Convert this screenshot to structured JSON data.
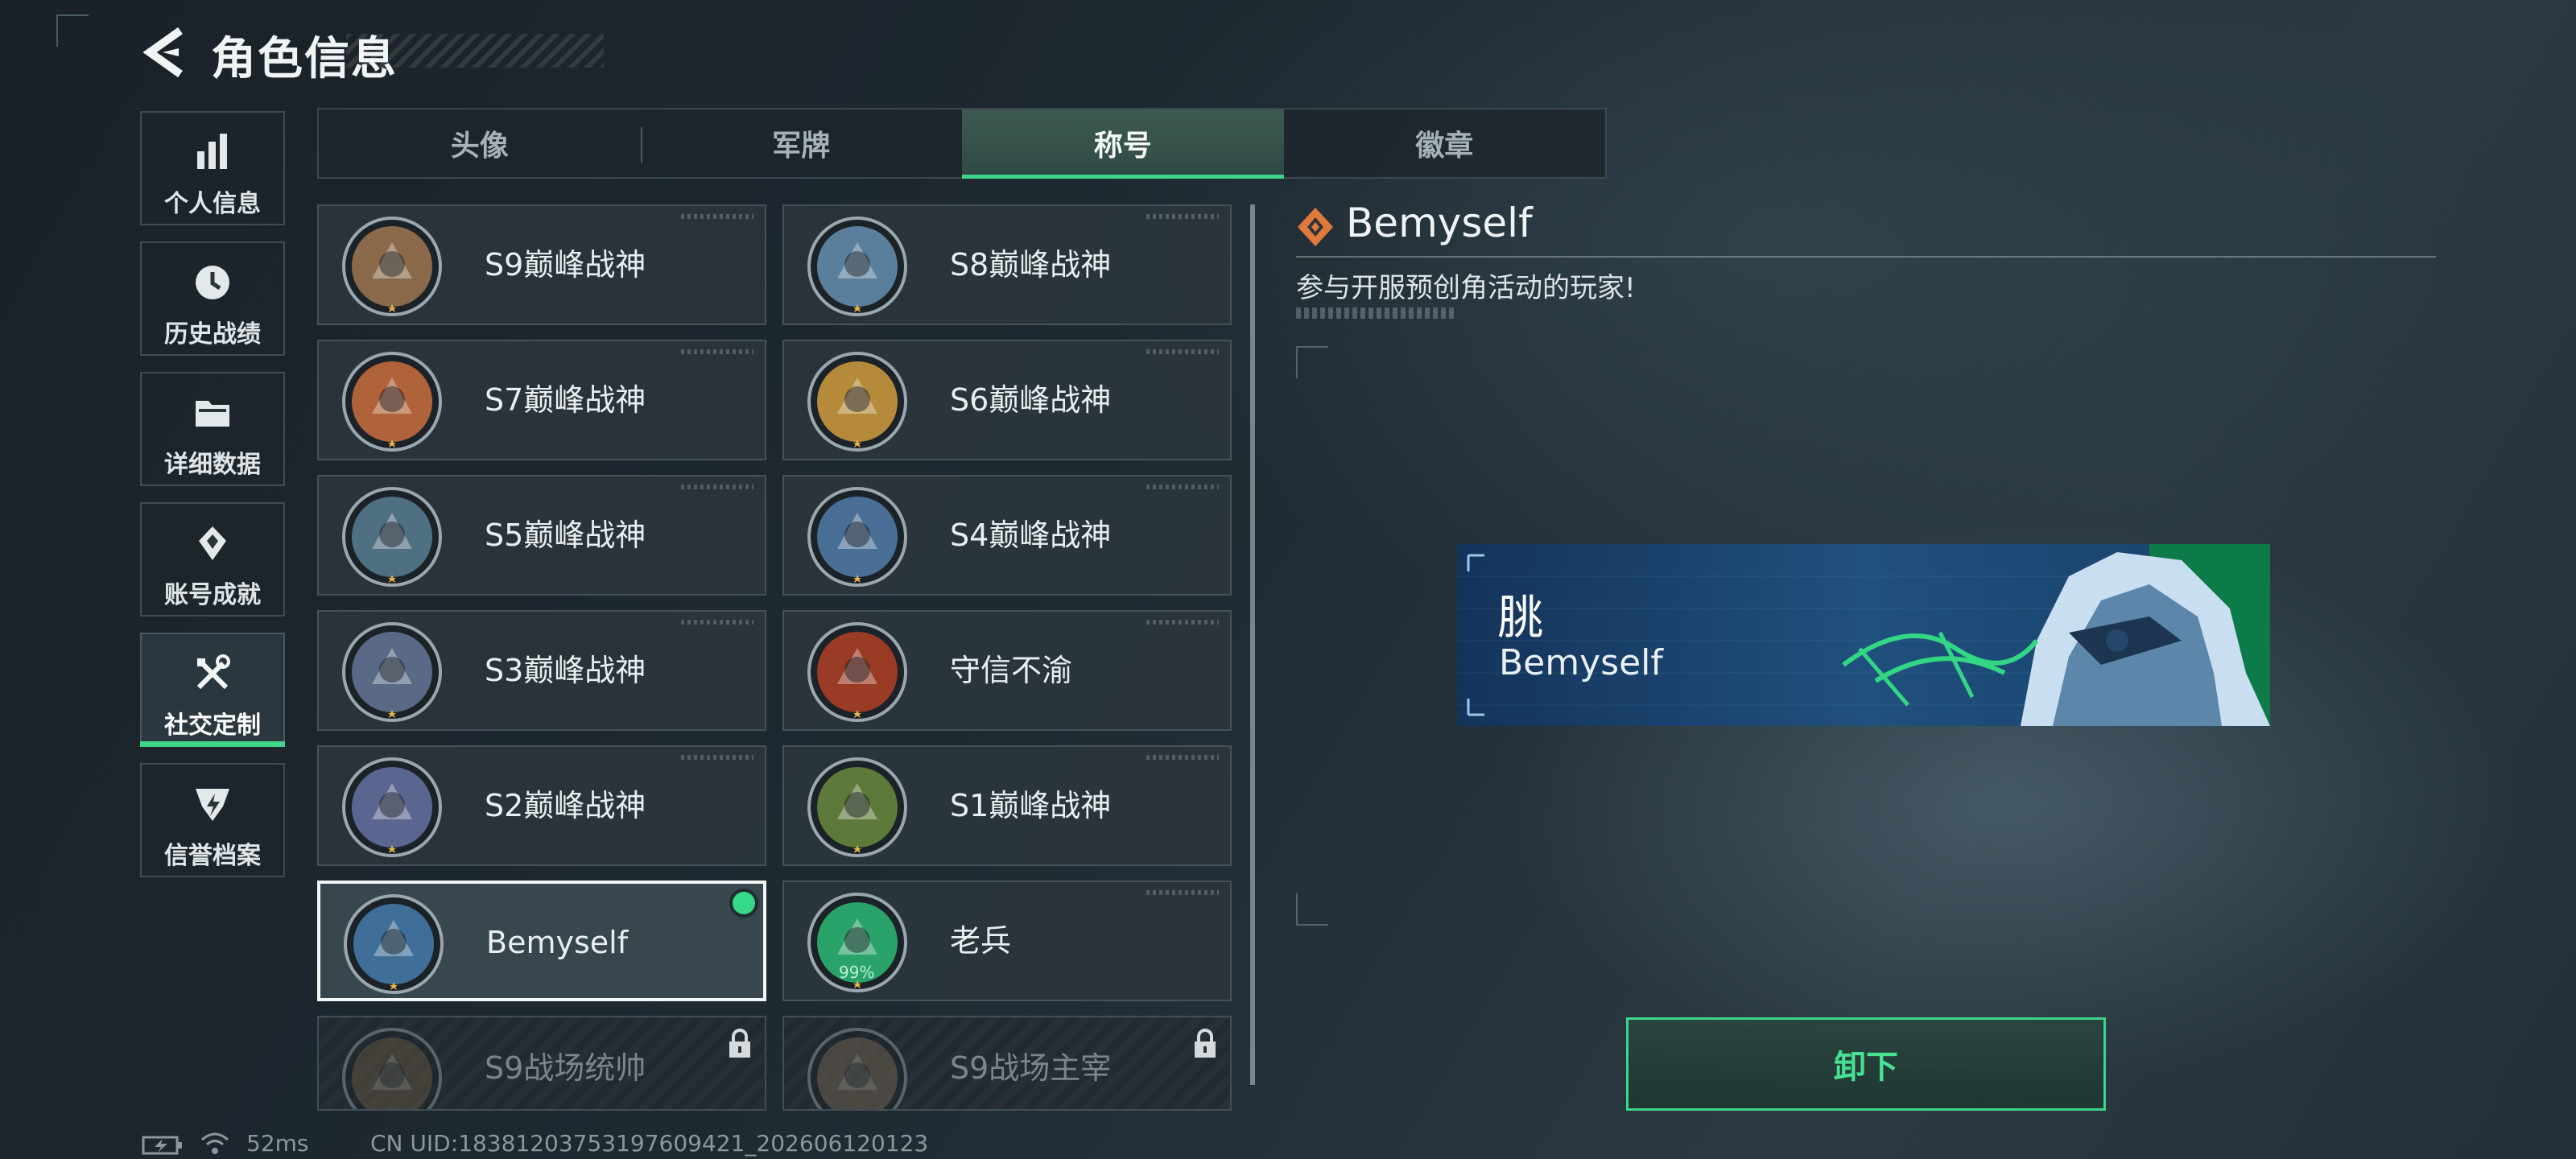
{
  "header": {
    "title": "角色信息"
  },
  "sidebar": {
    "items": [
      {
        "label": "个人信息",
        "icon": "bar-chart-icon"
      },
      {
        "label": "历史战绩",
        "icon": "history-clock-icon"
      },
      {
        "label": "详细数据",
        "icon": "folder-icon"
      },
      {
        "label": "账号成就",
        "icon": "achievement-icon"
      },
      {
        "label": "社交定制",
        "icon": "tools-icon",
        "active": true
      },
      {
        "label": "信誉档案",
        "icon": "credit-shield-icon"
      }
    ]
  },
  "tabs": [
    {
      "label": "头像"
    },
    {
      "label": "军牌"
    },
    {
      "label": "称号",
      "active": true
    },
    {
      "label": "徽章"
    }
  ],
  "titles": [
    {
      "name": "S9巅峰战神",
      "emblem": "fortress-emblem-icon",
      "state": "normal"
    },
    {
      "name": "S8巅峰战神",
      "emblem": "striped-shield-emblem-icon",
      "state": "normal"
    },
    {
      "name": "S7巅峰战神",
      "emblem": "weapon-emblem-icon",
      "state": "normal"
    },
    {
      "name": "S6巅峰战神",
      "emblem": "gold-t-emblem-icon",
      "state": "normal"
    },
    {
      "name": "S5巅峰战神",
      "emblem": "diver-mask-emblem-icon",
      "state": "normal"
    },
    {
      "name": "S4巅峰战神",
      "emblem": "night-vision-helmet-emblem-icon",
      "state": "normal"
    },
    {
      "name": "S3巅峰战神",
      "emblem": "globe-emblem-icon",
      "state": "normal"
    },
    {
      "name": "守信不渝",
      "emblem": "scales-emblem-icon",
      "state": "normal"
    },
    {
      "name": "S2巅峰战神",
      "emblem": "hazard-emblem-icon",
      "state": "normal"
    },
    {
      "name": "S1巅峰战神",
      "emblem": "crocodile-emblem-icon",
      "state": "normal"
    },
    {
      "name": "Bemyself",
      "emblem": "soldier-signature-emblem-icon",
      "state": "selected"
    },
    {
      "name": "老兵",
      "emblem": "veteran-triangle-emblem-icon",
      "state": "normal",
      "progress_text": "99%"
    },
    {
      "name": "S9战场统帅",
      "emblem": "tank-emblem-icon",
      "state": "locked"
    },
    {
      "name": "S9战场主宰",
      "emblem": "explosion-emblem-icon",
      "state": "locked"
    }
  ],
  "detail": {
    "name": "Bemyself",
    "description": "参与开服预创角活动的玩家!",
    "banner": {
      "character": "朓",
      "name": "Bemyself"
    },
    "action_label": "卸下"
  },
  "status": {
    "ping": "52ms",
    "uid": "CN UID:18381203753197609421_202606120123"
  },
  "colors": {
    "accent": "#3ed48a",
    "banner": "#1d4a75"
  }
}
